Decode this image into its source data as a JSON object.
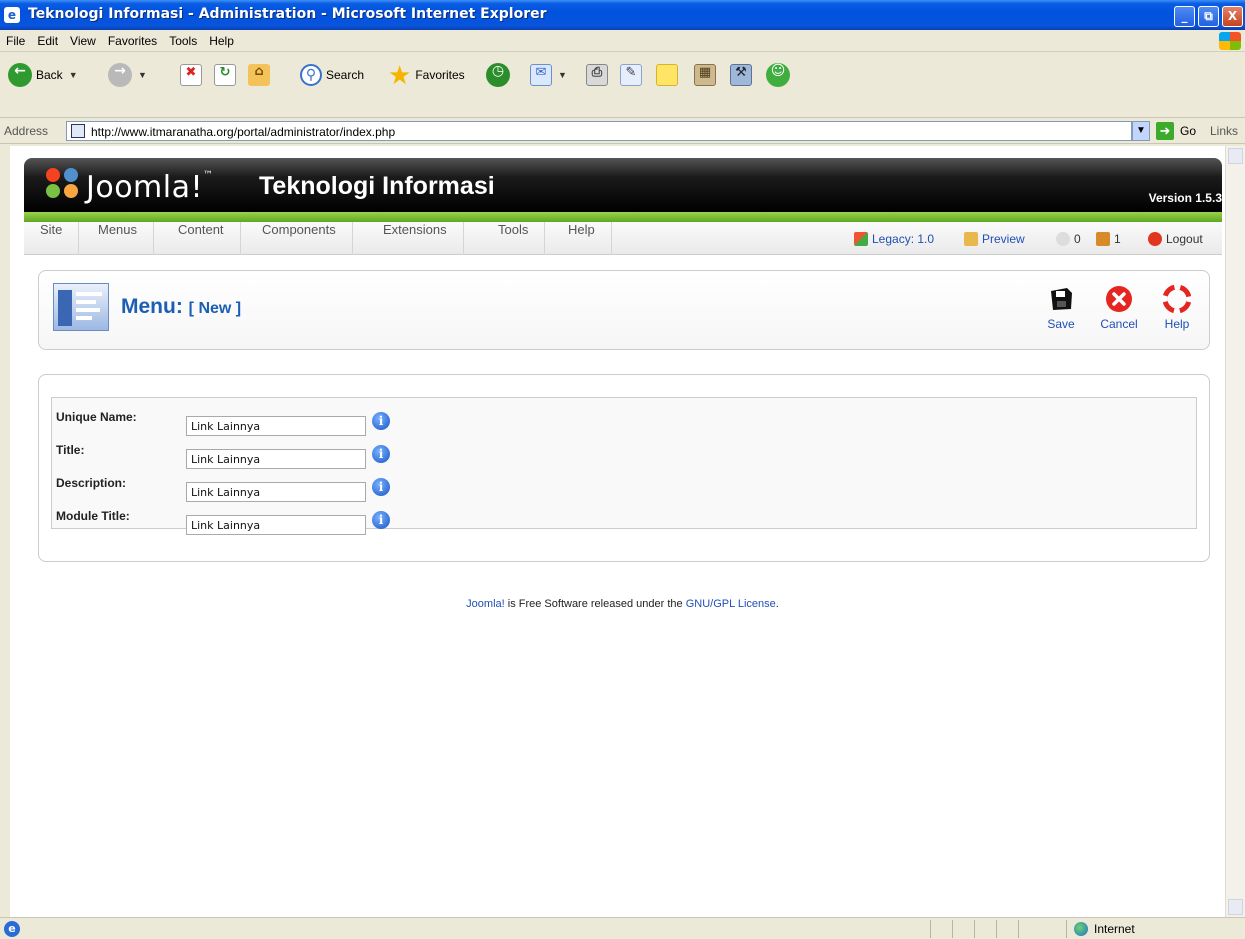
{
  "window": {
    "title": "Teknologi Informasi - Administration - Microsoft Internet Explorer",
    "buttons": [
      "_",
      "⧉",
      "X"
    ]
  },
  "ie_menu": [
    "File",
    "Edit",
    "View",
    "Favorites",
    "Tools",
    "Help"
  ],
  "ie_toolbar": {
    "back": "Back",
    "search": "Search",
    "favorites": "Favorites"
  },
  "address": {
    "label": "Address",
    "url": "http://www.itmaranatha.org/portal/administrator/index.php",
    "go": "Go",
    "links": "Links"
  },
  "joomla": {
    "brand": "Joomla!",
    "brand_mark": "™",
    "site_name": "Teknologi Informasi",
    "version": "Version 1.5.3",
    "nav": [
      "Site",
      "Menus",
      "Content",
      "Components",
      "Extensions",
      "Tools",
      "Help"
    ],
    "status": {
      "legacy": "Legacy: 1.0",
      "preview": "Preview",
      "messages": "0",
      "users": "1",
      "logout": "Logout"
    }
  },
  "page": {
    "title": "Menu:",
    "subtitle": "[ New ]",
    "toolbar": {
      "save": "Save",
      "cancel": "Cancel",
      "help": "Help"
    }
  },
  "form": {
    "fields": [
      {
        "label": "Unique Name:",
        "value": "Link Lainnya"
      },
      {
        "label": "Title:",
        "value": "Link Lainnya"
      },
      {
        "label": "Description:",
        "value": "Link Lainnya"
      },
      {
        "label": "Module Title:",
        "value": "Link Lainnya"
      }
    ]
  },
  "footer": {
    "link1": "Joomla!",
    "text": " is Free Software released under the ",
    "link2": "GNU/GPL License",
    "end": "."
  },
  "statusbar": {
    "zone": "Internet"
  },
  "colors": {
    "joomla_green": "#5fa824",
    "link_blue": "#1f4fb5",
    "title_blue": "#1a5fb4"
  }
}
